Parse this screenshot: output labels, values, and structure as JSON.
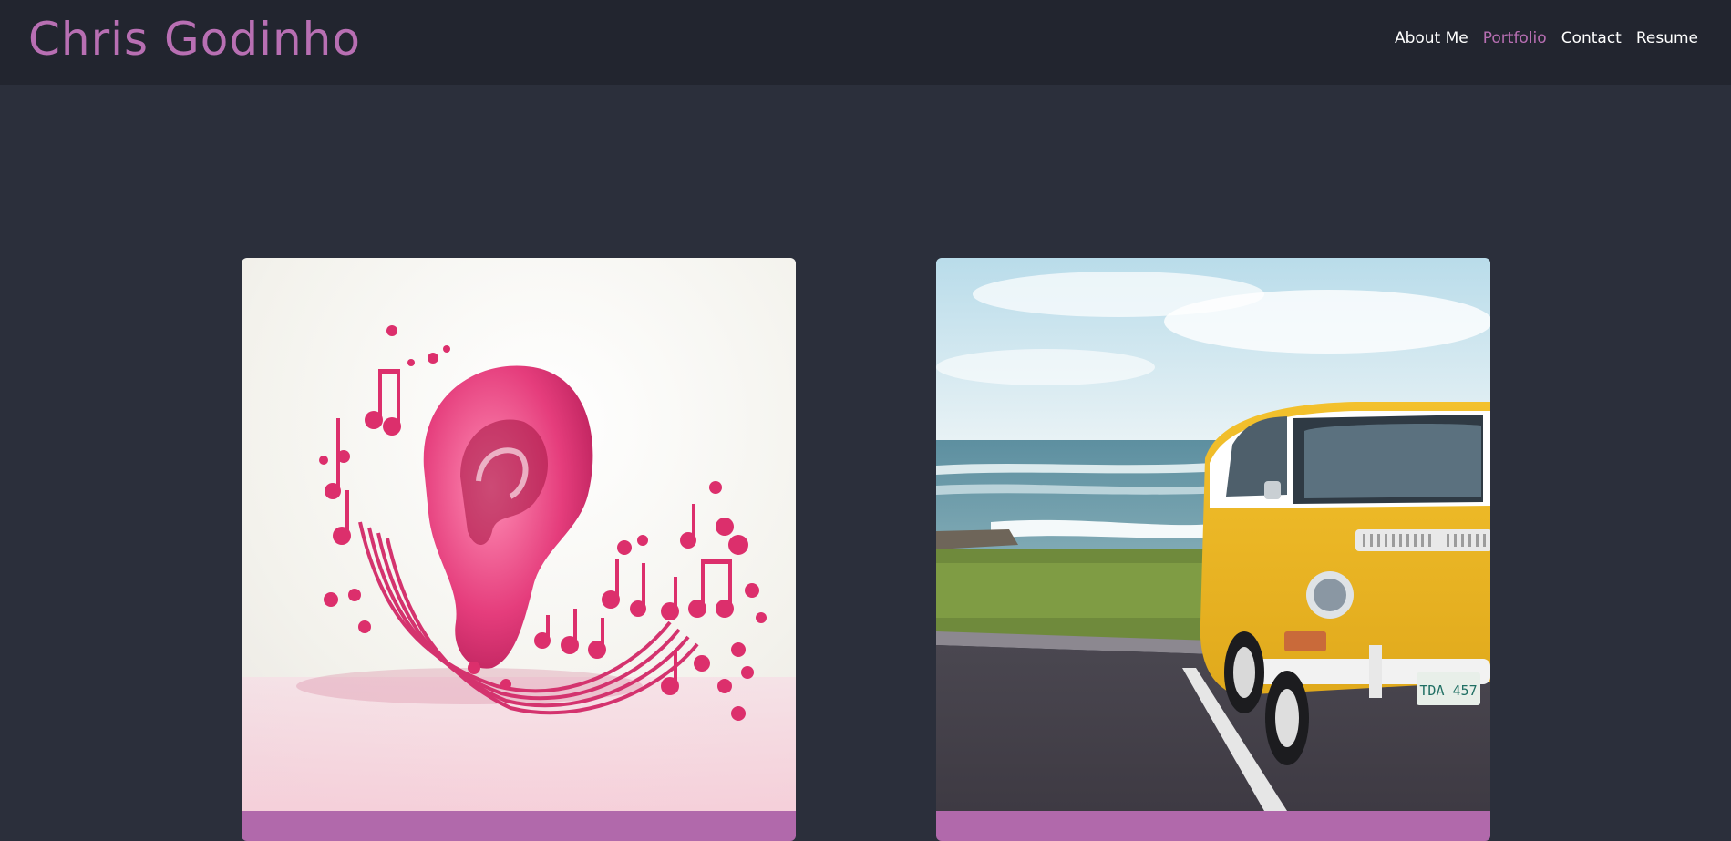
{
  "header": {
    "brand": "Chris Godinho",
    "nav": [
      {
        "label": "About Me",
        "active": false
      },
      {
        "label": "Portfolio",
        "active": true
      },
      {
        "label": "Contact",
        "active": false
      },
      {
        "label": "Resume",
        "active": false
      }
    ]
  },
  "portfolio": {
    "cards": [
      {
        "image": "pink-ear-with-music-notes"
      },
      {
        "image": "yellow-vw-van-by-ocean",
        "plate_text": "TDA 457"
      }
    ]
  },
  "colors": {
    "page_bg": "#2b2f3b",
    "header_bg": "#22252f",
    "accent": "#b86fb3",
    "nav_text": "#ffffff",
    "card_bar": "#b169ab"
  }
}
